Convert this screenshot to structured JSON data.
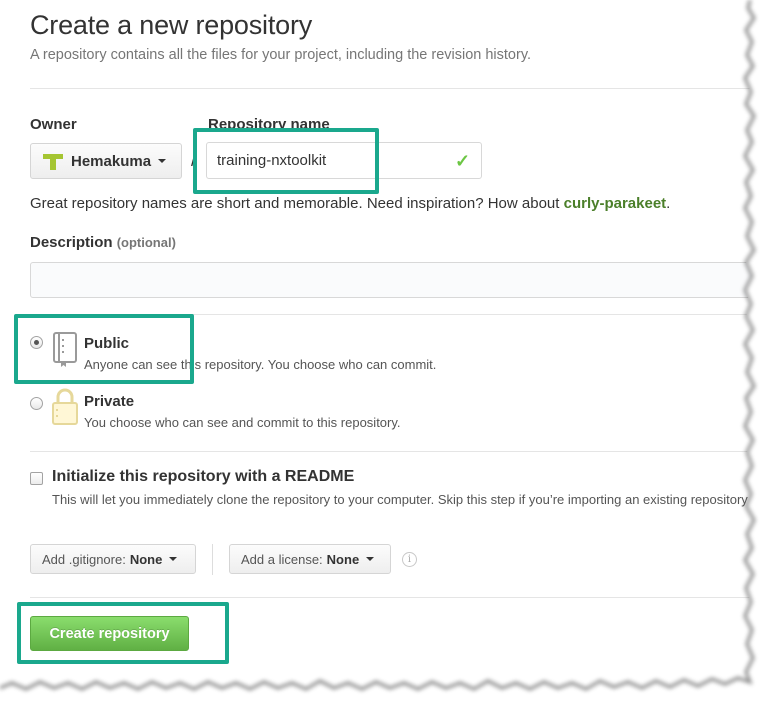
{
  "header": {
    "title": "Create a new repository",
    "subtitle": "A repository contains all the files for your project, including the revision history."
  },
  "owner": {
    "label": "Owner",
    "value": "Hemakuma",
    "separator": "/"
  },
  "repository": {
    "label": "Repository name",
    "value": "training-nxtoolkit",
    "hint_prefix": "Great repository names are short and memorable. Need inspiration? How about ",
    "hint_suggestion": "curly-parakeet",
    "hint_suffix": "."
  },
  "description": {
    "label": "Description",
    "optional": "(optional)",
    "value": ""
  },
  "visibility": {
    "public": {
      "title": "Public",
      "desc": "Anyone can see this repository. You choose who can commit.",
      "selected": true
    },
    "private": {
      "title": "Private",
      "desc": "You choose who can see and commit to this repository.",
      "selected": false
    }
  },
  "readme": {
    "title": "Initialize this repository with a README",
    "desc": "This will let you immediately clone the repository to your computer. Skip this step if you’re importing an existing repository.",
    "checked": false
  },
  "gitignore": {
    "label": "Add .gitignore:",
    "value": "None"
  },
  "license": {
    "label": "Add a license:",
    "value": "None"
  },
  "actions": {
    "create_label": "Create repository"
  },
  "colors": {
    "highlight": "#1aa88d",
    "button": "#60b044",
    "suggestion": "#4b7f2a",
    "check": "#6cc644"
  }
}
